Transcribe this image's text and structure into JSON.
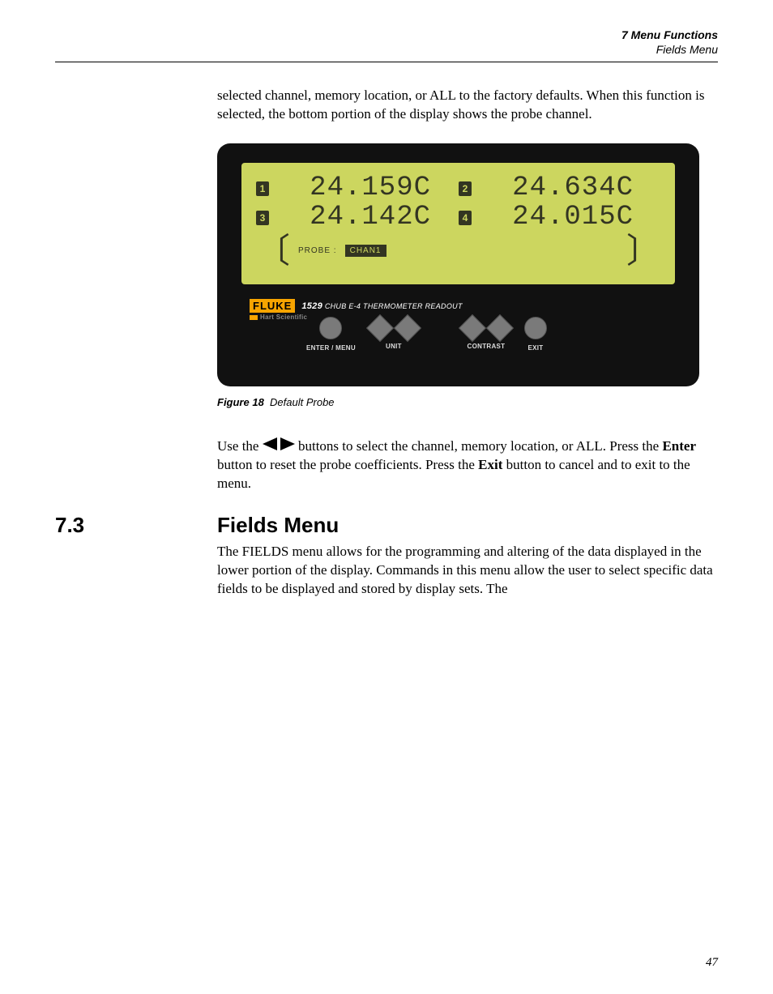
{
  "header": {
    "chapter": "7  Menu Functions",
    "section": "Fields Menu"
  },
  "intro_paragraph": "selected channel, memory location, or ALL to the factory defaults. When this function is selected, the bottom portion of the display shows the probe channel.",
  "device": {
    "readouts": [
      {
        "chan": "1",
        "value": "24.159C"
      },
      {
        "chan": "2",
        "value": "24.634C"
      },
      {
        "chan": "3",
        "value": "24.142C"
      },
      {
        "chan": "4",
        "value": "24.015C"
      }
    ],
    "probe_label": "PROBE :",
    "probe_selection": "CHAN1",
    "brand": "FLUKE",
    "subbrand": "Hart Scientific",
    "model_num": "1529",
    "model_name": "CHUB E-4 THERMOMETER READOUT",
    "buttons": {
      "enter": "ENTER / MENU",
      "unit": "UNIT",
      "contrast": "CONTRAST",
      "exit": "EXIT"
    }
  },
  "figure": {
    "label": "Figure 18",
    "caption": "Default Probe"
  },
  "usage_paragraph": {
    "pre": "Use the ",
    "mid": " buttons to select the channel, memory location, or ALL. Press the ",
    "enter": "Enter",
    "mid2": " button to reset the probe coefficients. Press the ",
    "exit": "Exit",
    "post": " button to cancel and to exit to the menu."
  },
  "section": {
    "number": "7.3",
    "title": "Fields Menu",
    "body": "The FIELDS menu allows for the programming and altering of the data displayed in the lower portion of the display. Commands in this menu allow the user to select specific data fields to be displayed and stored by display sets. The"
  },
  "page_number": "47"
}
